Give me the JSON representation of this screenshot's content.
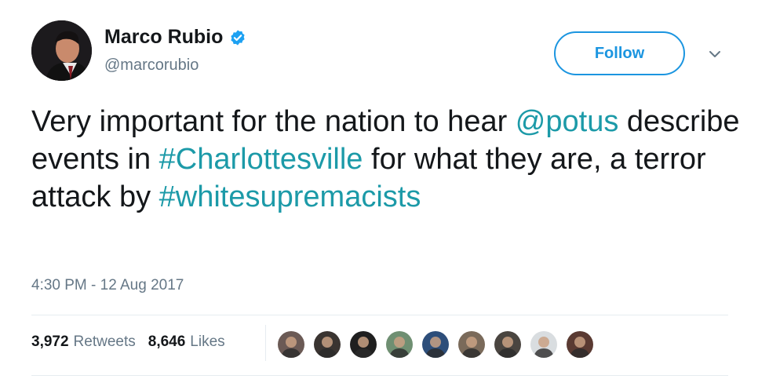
{
  "user": {
    "display_name": "Marco Rubio",
    "handle": "@marcorubio",
    "verified": true
  },
  "follow_button": {
    "label": "Follow"
  },
  "tweet": {
    "segments": [
      {
        "text": "Very important for the nation to hear ",
        "link": false
      },
      {
        "text": "@potus",
        "link": true
      },
      {
        "text": " describe events in ",
        "link": false
      },
      {
        "text": "#Charlottesville",
        "link": true
      },
      {
        "text": " for what they are, a terror attack by ",
        "link": false
      },
      {
        "text": "#whitesupremacists",
        "link": true
      }
    ],
    "timestamp": "4:30 PM - 12 Aug 2017"
  },
  "stats": {
    "retweets_count": "3,972",
    "retweets_label": "Retweets",
    "likes_count": "8,646",
    "likes_label": "Likes"
  },
  "colors": {
    "link": "#1c9aa8",
    "follow_accent": "#1b95e0",
    "secondary_text": "#657786",
    "verified_badge": "#1da1f2"
  },
  "likers": [
    {
      "icon": "liker-avatar",
      "bg": "#6b5a55"
    },
    {
      "icon": "liker-avatar",
      "bg": "#3a3431"
    },
    {
      "icon": "liker-avatar",
      "bg": "#1f1f1f"
    },
    {
      "icon": "liker-avatar",
      "bg": "#6f8f72"
    },
    {
      "icon": "liker-avatar",
      "bg": "#2d4e7a"
    },
    {
      "icon": "liker-avatar",
      "bg": "#7a6a5a"
    },
    {
      "icon": "liker-avatar",
      "bg": "#4a4540"
    },
    {
      "icon": "liker-avatar",
      "bg": "#d9dde0"
    },
    {
      "icon": "liker-avatar",
      "bg": "#5a3a32"
    }
  ]
}
